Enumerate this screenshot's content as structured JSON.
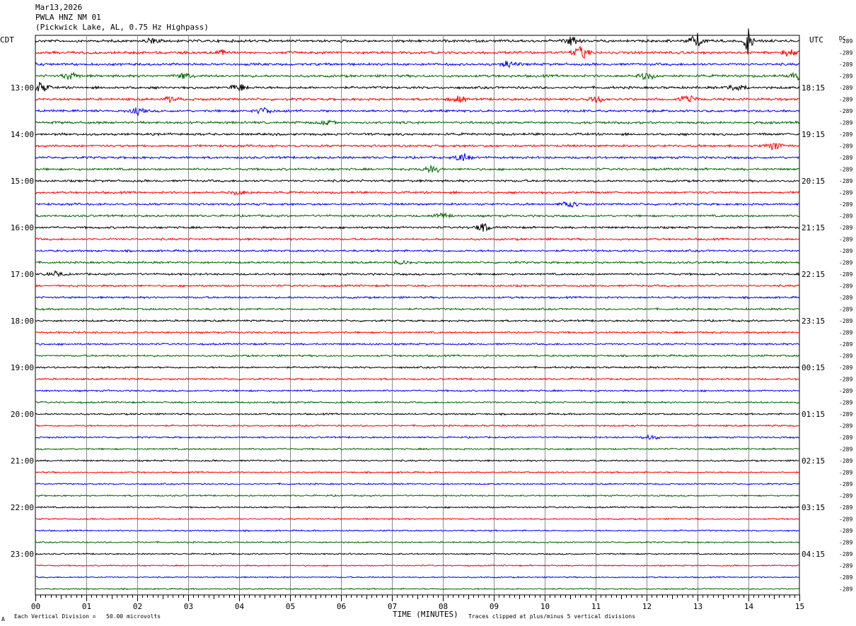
{
  "header": {
    "date": "Mar13,2026",
    "station": "PWLA HNZ NM 01",
    "location": "(Pickwick Lake, AL, 0.75 Hz Highpass)"
  },
  "axes": {
    "left_zone": "CDT",
    "right_zone": "UTC",
    "right_col_header": "DC",
    "dc_value": "-289",
    "xlabel": "TIME (MINUTES)"
  },
  "footer": {
    "scale_note": "Each Vertical Division =   50.00 microvolts",
    "clip_note": "Traces clipped at plus/minus 5 vertical divisions",
    "corner_mark": "A"
  },
  "chart_data": {
    "type": "line",
    "title": "PWLA HNZ NM 01",
    "xlabel": "TIME (MINUTES)",
    "xlim": [
      0,
      15
    ],
    "x_ticks": [
      "00",
      "01",
      "02",
      "03",
      "04",
      "05",
      "06",
      "07",
      "08",
      "09",
      "10",
      "11",
      "12",
      "13",
      "14",
      "15"
    ],
    "trace_count": 48,
    "trace_minutes": 15,
    "trace_colors": [
      "#000000",
      "#ff0000",
      "#0000ff",
      "#006400"
    ],
    "left_hour_labels": [
      {
        "trace": 4,
        "label": "13:00"
      },
      {
        "trace": 8,
        "label": "14:00"
      },
      {
        "trace": 12,
        "label": "15:00"
      },
      {
        "trace": 16,
        "label": "16:00"
      },
      {
        "trace": 20,
        "label": "17:00"
      },
      {
        "trace": 24,
        "label": "18:00"
      },
      {
        "trace": 28,
        "label": "19:00"
      },
      {
        "trace": 32,
        "label": "20:00"
      },
      {
        "trace": 36,
        "label": "21:00"
      },
      {
        "trace": 40,
        "label": "22:00"
      },
      {
        "trace": 44,
        "label": "23:00"
      }
    ],
    "right_hour_labels": [
      {
        "trace": 4,
        "label": "18:15"
      },
      {
        "trace": 8,
        "label": "19:15"
      },
      {
        "trace": 12,
        "label": "20:15"
      },
      {
        "trace": 16,
        "label": "21:15"
      },
      {
        "trace": 20,
        "label": "22:15"
      },
      {
        "trace": 24,
        "label": "23:15"
      },
      {
        "trace": 28,
        "label": "00:15"
      },
      {
        "trace": 32,
        "label": "01:15"
      },
      {
        "trace": 36,
        "label": "02:15"
      },
      {
        "trace": 40,
        "label": "03:15"
      },
      {
        "trace": 44,
        "label": "04:15"
      }
    ],
    "dc_offset": -289,
    "scale_microvolts_per_division": 50.0,
    "clip_divisions": 5,
    "events": [
      {
        "trace": 0,
        "minute": 14.0,
        "amplitude": 1.8
      },
      {
        "trace": 0,
        "minute": 13.0,
        "amplitude": 0.6
      },
      {
        "trace": 0,
        "minute": 10.5,
        "amplitude": 0.4
      },
      {
        "trace": 0,
        "minute": 2.3,
        "amplitude": 0.3
      },
      {
        "trace": 1,
        "minute": 10.7,
        "amplitude": 0.6
      },
      {
        "trace": 1,
        "minute": 14.8,
        "amplitude": 0.4
      },
      {
        "trace": 1,
        "minute": 3.6,
        "amplitude": 0.3
      },
      {
        "trace": 2,
        "minute": 9.3,
        "amplitude": 0.3
      },
      {
        "trace": 3,
        "minute": 15.0,
        "amplitude": 0.7
      },
      {
        "trace": 3,
        "minute": 0.7,
        "amplitude": 0.4
      },
      {
        "trace": 3,
        "minute": 2.9,
        "amplitude": 0.3
      },
      {
        "trace": 3,
        "minute": 12.0,
        "amplitude": 0.4
      },
      {
        "trace": 4,
        "minute": 0.1,
        "amplitude": 0.5
      },
      {
        "trace": 4,
        "minute": 4.0,
        "amplitude": 0.4
      },
      {
        "trace": 4,
        "minute": 13.8,
        "amplitude": 0.5
      },
      {
        "trace": 5,
        "minute": 2.7,
        "amplitude": 0.3
      },
      {
        "trace": 5,
        "minute": 8.3,
        "amplitude": 0.4
      },
      {
        "trace": 5,
        "minute": 12.8,
        "amplitude": 0.4
      },
      {
        "trace": 5,
        "minute": 11.0,
        "amplitude": 0.3
      },
      {
        "trace": 6,
        "minute": 2.0,
        "amplitude": 0.3
      },
      {
        "trace": 6,
        "minute": 4.5,
        "amplitude": 0.3
      },
      {
        "trace": 7,
        "minute": 5.7,
        "amplitude": 0.2
      },
      {
        "trace": 9,
        "minute": 14.5,
        "amplitude": 0.5
      },
      {
        "trace": 10,
        "minute": 8.4,
        "amplitude": 0.4
      },
      {
        "trace": 11,
        "minute": 7.8,
        "amplitude": 0.4
      },
      {
        "trace": 13,
        "minute": 4.0,
        "amplitude": 0.2
      },
      {
        "trace": 14,
        "minute": 10.5,
        "amplitude": 0.3
      },
      {
        "trace": 15,
        "minute": 8.0,
        "amplitude": 0.3
      },
      {
        "trace": 16,
        "minute": 8.8,
        "amplitude": 0.4
      },
      {
        "trace": 19,
        "minute": 7.2,
        "amplitude": 0.2
      },
      {
        "trace": 20,
        "minute": 0.4,
        "amplitude": 0.2
      },
      {
        "trace": 34,
        "minute": 12.1,
        "amplitude": 0.2
      }
    ]
  }
}
